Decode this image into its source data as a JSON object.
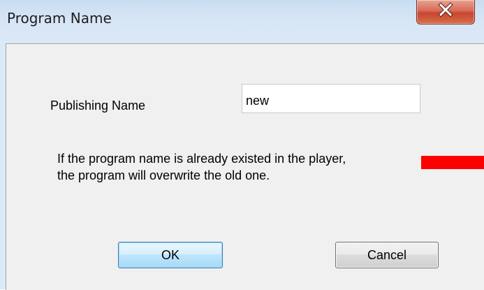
{
  "window": {
    "title": "Program Name"
  },
  "form": {
    "publishing_label": "Publishing Name",
    "publishing_value": "new"
  },
  "message": {
    "text": "If the program name is already existed in the player,\nthe program will overwrite the old one."
  },
  "buttons": {
    "ok_label": "OK",
    "cancel_label": "Cancel"
  },
  "colors": {
    "redaction": "#ff0000",
    "close_button": "#c74631",
    "ok_button_border": "#3c7fb1"
  },
  "icons": {
    "close": "close-icon"
  }
}
